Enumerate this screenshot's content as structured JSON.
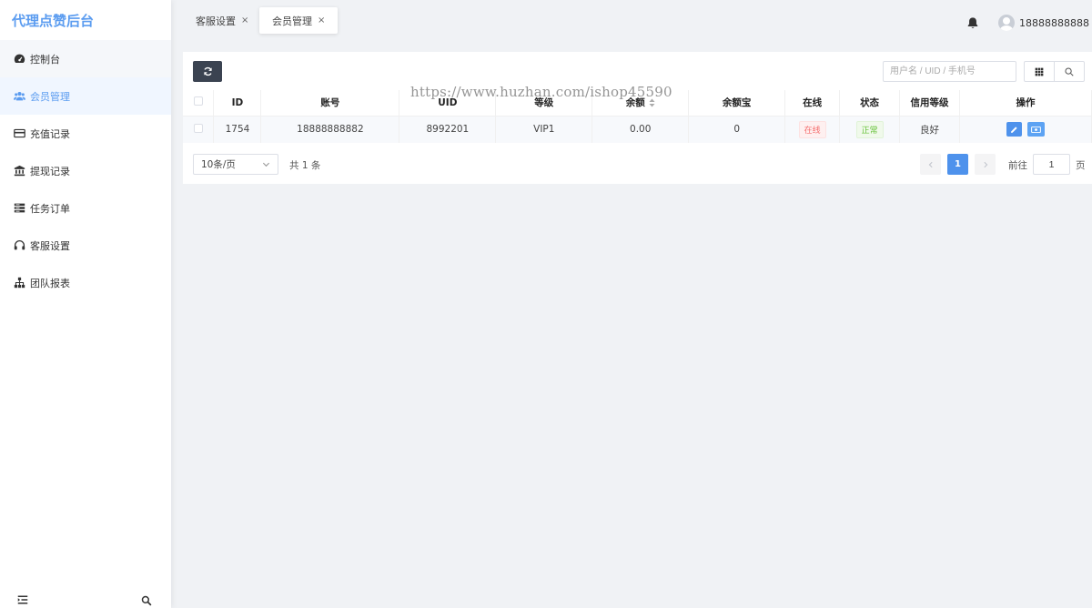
{
  "brand": "代理点赞后台",
  "sidebar": {
    "items": [
      {
        "label": "控制台",
        "icon": "dashboard-icon"
      },
      {
        "label": "会员管理",
        "icon": "users-icon"
      },
      {
        "label": "充值记录",
        "icon": "credit-card-icon"
      },
      {
        "label": "提现记录",
        "icon": "bank-icon"
      },
      {
        "label": "任务订单",
        "icon": "list-icon"
      },
      {
        "label": "客服设置",
        "icon": "headset-icon"
      },
      {
        "label": "团队报表",
        "icon": "sitemap-icon"
      }
    ],
    "active_index": 1
  },
  "tabs": [
    {
      "label": "客服设置",
      "close": "×"
    },
    {
      "label": "会员管理",
      "close": "×"
    }
  ],
  "header": {
    "username": "18888888888"
  },
  "toolbar": {
    "search_placeholder": "用户名 / UID / 手机号"
  },
  "table": {
    "columns": [
      "ID",
      "账号",
      "UID",
      "等级",
      "余额",
      "余额宝",
      "在线",
      "状态",
      "信用等级",
      "操作"
    ],
    "rows": [
      {
        "id": "1754",
        "account": "18888888882",
        "uid": "8992201",
        "level": "VIP1",
        "balance": "0.00",
        "yuebao": "0",
        "online": "在线",
        "status": "正常",
        "credit": "良好"
      }
    ]
  },
  "pager": {
    "page_size": "10条/页",
    "total": "共 1 条",
    "current": "1",
    "goto_label": "前往",
    "goto_value": "1",
    "unit": "页"
  },
  "watermark": "https://www.huzhan.com/ishop45590",
  "colors": {
    "accent": "#5b9cf0",
    "primary_button": "#4e92ec",
    "dark_button": "#3b4351",
    "online_tag": "#f56c6c",
    "normal_tag": "#67c23a"
  }
}
